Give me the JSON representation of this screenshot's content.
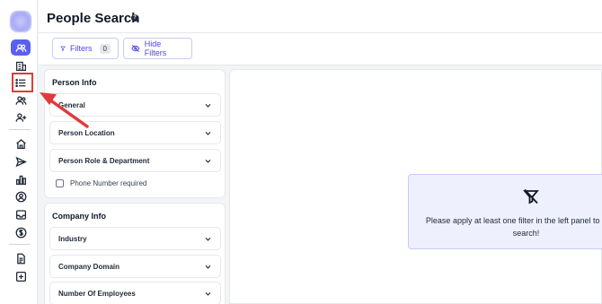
{
  "header": {
    "title": "People Search",
    "help_icon": "question-circle-icon"
  },
  "toolbar": {
    "filters_label": "Filters",
    "filters_count": "0",
    "hide_filters_label": "Hide Filters"
  },
  "person_info": {
    "title": "Person Info",
    "items": [
      "General",
      "Person Location",
      "Person Role & Department"
    ],
    "phone_checkbox_label": "Phone Number required"
  },
  "company_info": {
    "title": "Company Info",
    "items": [
      "Industry",
      "Company Domain",
      "Number Of Employees"
    ]
  },
  "empty_state": {
    "message": "Please apply at least one filter in the left panel to people search!"
  },
  "sidebar_icons": [
    "logo",
    "people-icon",
    "building-icon",
    "list-icon",
    "users-icon",
    "user-plus-icon",
    "home-icon",
    "send-icon",
    "bar-chart-icon",
    "user-circle-icon",
    "inbox-icon",
    "dollar-icon",
    "document-icon",
    "plus-square-icon"
  ],
  "colors": {
    "accent": "#5b5ff0",
    "annotation": "#e03b3b",
    "empty_card_bg": "#eef0fd"
  }
}
